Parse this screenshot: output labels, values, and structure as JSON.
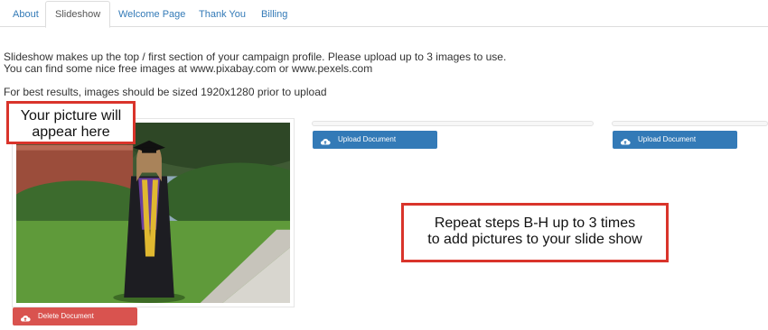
{
  "tabs": [
    {
      "label": "About"
    },
    {
      "label": "Slideshow"
    },
    {
      "label": "Welcome Page"
    },
    {
      "label": "Thank You"
    },
    {
      "label": "Billing"
    }
  ],
  "active_tab": "Slideshow",
  "intro": {
    "line1": "Slideshow makes up the top / first section of your campaign profile. Please upload up to 3 images to use.",
    "line2": "You can find some nice free images at www.pixabay.com or www.pexels.com",
    "line3": "For best results, images should be sized 1920x1280 prior to upload"
  },
  "callouts": {
    "picture_line1": "Your picture will",
    "picture_line2": "appear here",
    "repeat_line1": "Repeat steps B-H up to 3 times",
    "repeat_line2": "to add pictures to your slide show"
  },
  "buttons": {
    "delete": "Delete Document",
    "upload_2": "Upload Document",
    "upload_3": "Upload Document"
  },
  "colors": {
    "link": "#337ab7",
    "primary_button": "#337ab7",
    "danger_button": "#d9534f",
    "callout_border": "#d9342b"
  },
  "icons": {
    "button_icon": "cloud-upload-icon"
  }
}
